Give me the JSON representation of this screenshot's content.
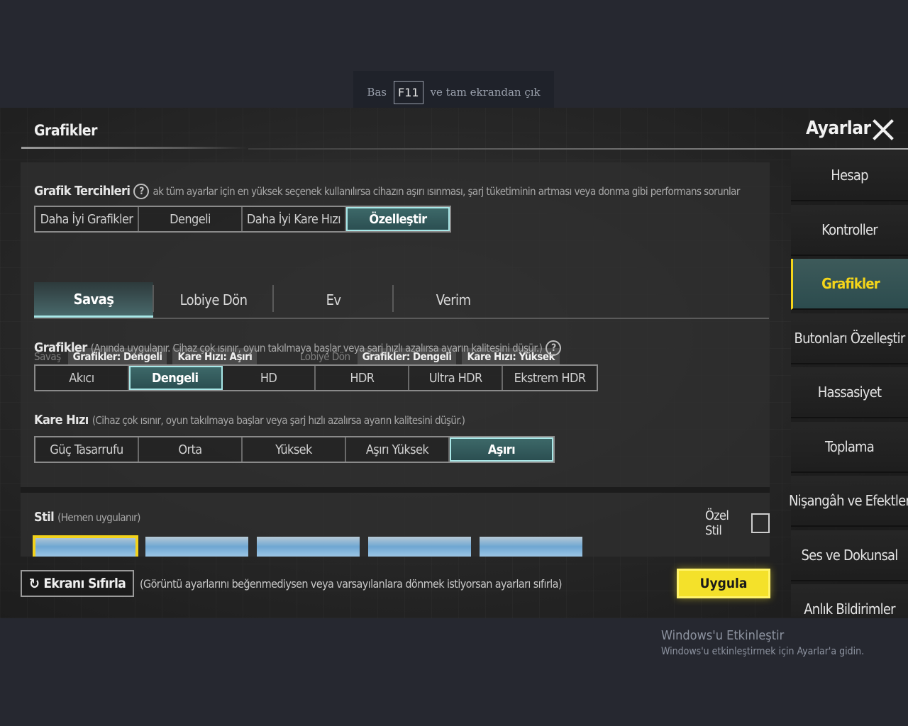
{
  "f11_banner": {
    "prefix": "Bas",
    "key": "F11",
    "suffix": "ve tam ekrandan çık"
  },
  "header": {
    "page_title": "Grafikler",
    "settings_title": "Ayarlar"
  },
  "graphics_preferences": {
    "title": "Grafik Tercihleri",
    "help_glyph": "?",
    "description": "ak tüm ayarlar için en yüksek seçenek kullanılırsa cihazın aşırı ısınması, şarj tüketiminin artması veya donma gibi performans sorunlar",
    "options": [
      "Daha İyi Grafikler",
      "Dengeli",
      "Daha İyi Kare Hızı",
      "Özelleştir"
    ],
    "selected": "Özelleştir",
    "battle": {
      "label": "Savaş",
      "graphics": "Grafikler: Dengeli",
      "fps": "Kare Hızı: Aşırı"
    },
    "lobby": {
      "label": "Lobiye Dön",
      "graphics": "Grafikler: Dengeli",
      "fps": "Kare Hızı: Yüksek"
    }
  },
  "mode_tabs": {
    "items": [
      "Savaş",
      "Lobiye Dön",
      "Ev",
      "Verim"
    ],
    "selected": "Savaş"
  },
  "graphics_quality": {
    "title": "Grafikler",
    "description": "(Anında uygulanır. Cihaz çok ısınır, oyun takılmaya başlar veya şarj hızlı azalırsa ayarın kalitesini düşür.)",
    "help_glyph": "?",
    "options": [
      "Akıcı",
      "Dengeli",
      "HD",
      "HDR",
      "Ultra HDR",
      "Ekstrem HDR"
    ],
    "selected": "Dengeli"
  },
  "frame_rate": {
    "title": "Kare Hızı",
    "description": "(Cihaz çok ısınır, oyun takılmaya başlar veya şarj hızlı azalırsa ayarın kalitesini düşür.)",
    "options": [
      "Güç Tasarrufu",
      "Orta",
      "Yüksek",
      "Aşırı Yüksek",
      "Aşırı"
    ],
    "selected": "Aşırı"
  },
  "style": {
    "title": "Stil",
    "description": "(Hemen uygulanır)",
    "custom_label": "Özel Stil",
    "custom_checked": false,
    "thumbnail_count": 5,
    "selected_index": 0
  },
  "bottom": {
    "reset_icon": "↻",
    "reset_label": "Ekranı Sıfırla",
    "reset_hint": "(Görüntü ayarlarını beğenmediysen veya varsayılanlara dönmek istiyorsan ayarları sıfırla)",
    "apply_label": "Uygula"
  },
  "sidebar": {
    "items": [
      "Hesap",
      "Kontroller",
      "Grafikler",
      "Butonları Özelleştir",
      "Hassasiyet",
      "Toplama",
      "Nişangâh ve Efektler",
      "Ses ve Dokunsal",
      "Anlık Bildirimler"
    ],
    "selected": "Grafikler"
  },
  "windows_activation": {
    "title": "Windows'u Etkinleştir",
    "subtitle": "Windows'u etkinleştirmek için Ayarlar'a gidin."
  },
  "colors": {
    "accent_teal": "#a9e8e8",
    "apply_yellow": "#f4e12a",
    "active_sidebar_text": "#f4d51a"
  }
}
